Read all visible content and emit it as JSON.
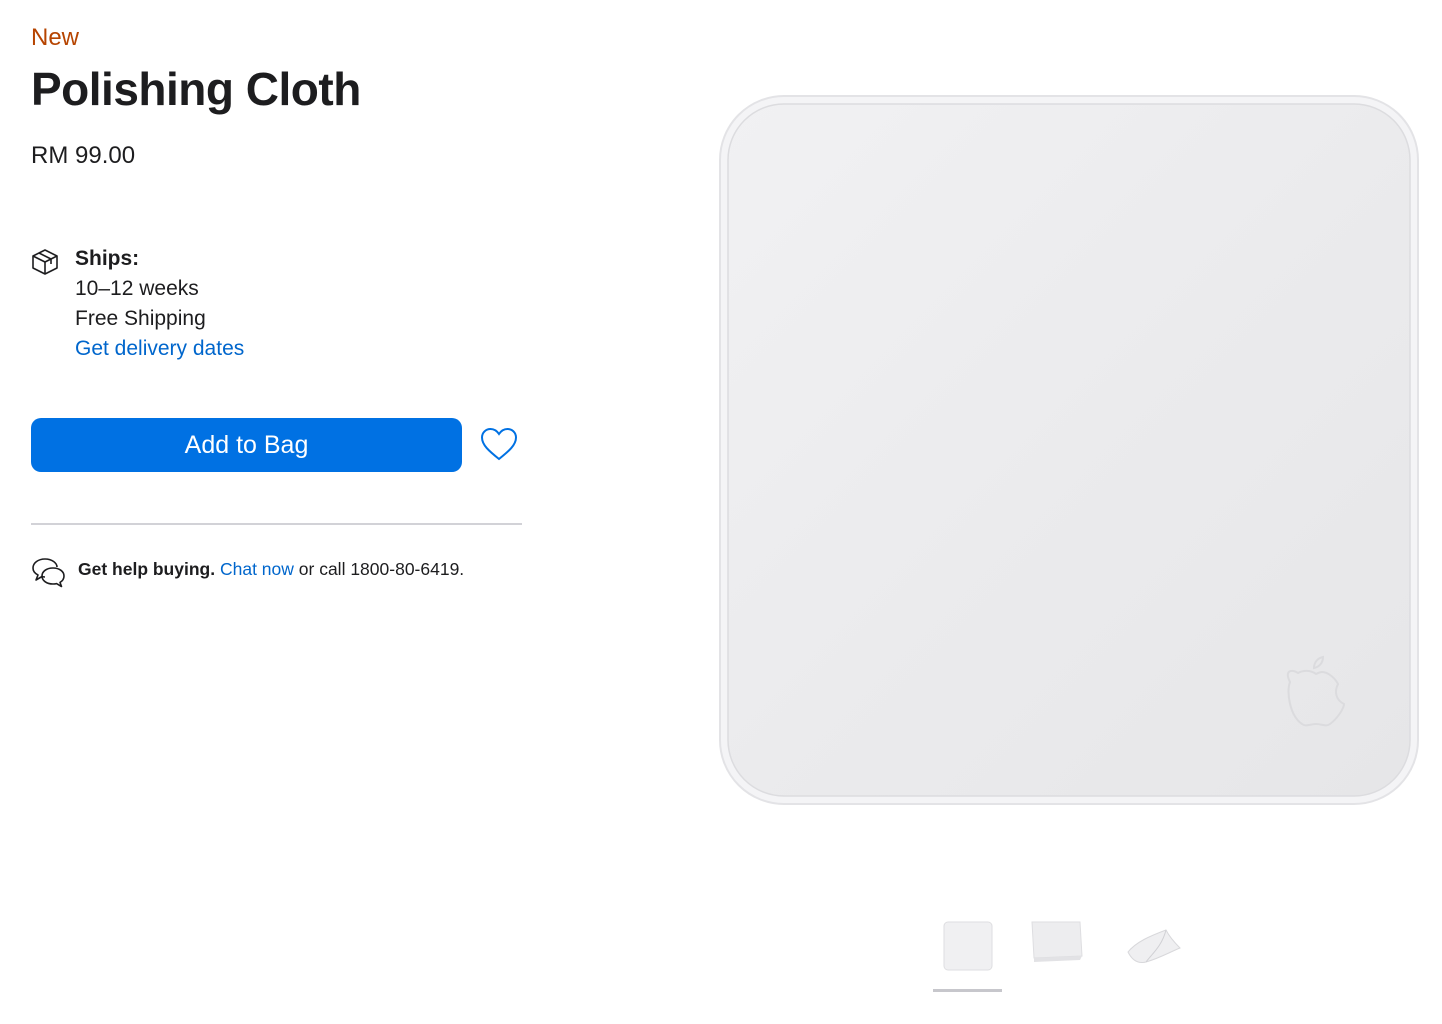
{
  "product": {
    "badge": "New",
    "title": "Polishing Cloth",
    "price": "RM 99.00"
  },
  "shipping": {
    "icon": "box-icon",
    "label": "Ships:",
    "eta": "10–12 weeks",
    "cost": "Free Shipping",
    "delivery_link": "Get delivery dates"
  },
  "actions": {
    "add_to_bag": "Add to Bag",
    "favorite_icon": "heart-icon"
  },
  "help": {
    "icon": "chat-bubbles-icon",
    "lead": "Get help buying.",
    "chat_link": "Chat now",
    "call_text": "or call 1800-80-6419."
  },
  "gallery": {
    "selected_index": 0,
    "thumbnails": [
      "polishing-cloth-front",
      "polishing-cloth-angled",
      "polishing-cloth-folded"
    ]
  },
  "colors": {
    "badge": "#b64400",
    "accent": "#0071e3",
    "link": "#0066cc",
    "text": "#1d1d1f"
  }
}
